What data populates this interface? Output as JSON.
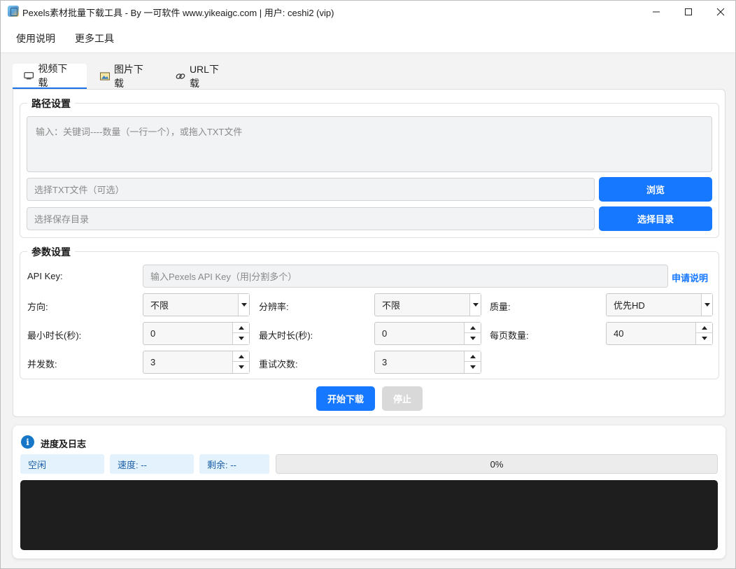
{
  "window": {
    "title": "Pexels素材批量下载工具 - By 一可软件 www.yikeaigc.com | 用户: ceshi2 (vip)",
    "minimize_glyph": "—",
    "maximize_glyph": "☐",
    "close_glyph": "✕"
  },
  "menu": {
    "items": [
      "使用说明",
      "更多工具"
    ]
  },
  "tabs": [
    {
      "label": "视频下载",
      "icon": "video-icon",
      "active": true
    },
    {
      "label": "图片下载",
      "icon": "image-icon",
      "active": false
    },
    {
      "label": "URL下载",
      "icon": "link-icon",
      "active": false
    }
  ],
  "path_settings": {
    "title": "路径设置",
    "keywords_placeholder": "输入：关键词----数量（一行一个），或拖入TXT文件",
    "txt_placeholder": "选择TXT文件（可选）",
    "browse_label": "浏览",
    "save_dir_placeholder": "选择保存目录",
    "select_dir_label": "选择目录"
  },
  "params": {
    "title": "参数设置",
    "api_key_label": "API Key:",
    "api_key_placeholder": "输入Pexels API Key（用|分割多个）",
    "api_help_link": "申请说明",
    "orientation_label": "方向:",
    "orientation_value": "不限",
    "resolution_label": "分辨率:",
    "resolution_value": "不限",
    "quality_label": "质量:",
    "quality_value": "优先HD",
    "min_duration_label": "最小时长(秒):",
    "min_duration_value": "0",
    "max_duration_label": "最大时长(秒):",
    "max_duration_value": "0",
    "per_page_label": "每页数量:",
    "per_page_value": "40",
    "concurrency_label": "并发数:",
    "concurrency_value": "3",
    "retries_label": "重试次数:",
    "retries_value": "3"
  },
  "actions": {
    "start_label": "开始下载",
    "stop_label": "停止"
  },
  "log": {
    "title": "进度及日志",
    "status": "空闲",
    "speed": "速度: --",
    "remaining": "剩余: --",
    "progress_percent": 0,
    "progress_text": "0%"
  },
  "colors": {
    "accent": "#1677ff",
    "console_bg": "#1e1e1e",
    "stat_bg": "#e3f2fc"
  }
}
